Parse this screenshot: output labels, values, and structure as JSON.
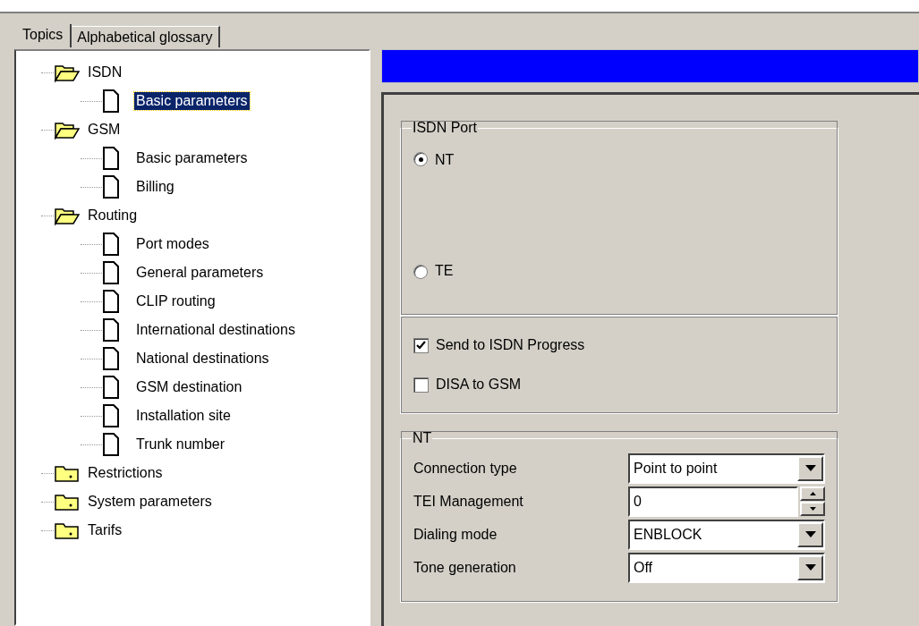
{
  "tabs": [
    {
      "label": "Topics",
      "selected": true
    },
    {
      "label": "Alphabetical glossary",
      "selected": false
    }
  ],
  "tree": [
    {
      "label": "ISDN",
      "expanded": true,
      "selected": false,
      "children": [
        {
          "label": "Basic parameters",
          "selected": true
        }
      ]
    },
    {
      "label": "GSM",
      "expanded": true,
      "selected": false,
      "children": [
        {
          "label": "Basic parameters",
          "selected": false
        },
        {
          "label": "Billing",
          "selected": false
        }
      ]
    },
    {
      "label": "Routing",
      "expanded": true,
      "selected": false,
      "children": [
        {
          "label": "Port modes",
          "selected": false
        },
        {
          "label": "General parameters",
          "selected": false
        },
        {
          "label": "CLIP routing",
          "selected": false
        },
        {
          "label": "International destinations",
          "selected": false
        },
        {
          "label": "National destinations",
          "selected": false
        },
        {
          "label": "GSM destination",
          "selected": false
        },
        {
          "label": "Installation site",
          "selected": false
        },
        {
          "label": "Trunk number",
          "selected": false
        }
      ]
    },
    {
      "label": "Restrictions",
      "expanded": false,
      "selected": false
    },
    {
      "label": "System parameters",
      "expanded": false,
      "selected": false
    },
    {
      "label": "Tarifs",
      "expanded": false,
      "selected": false
    }
  ],
  "isdn_port": {
    "title": "ISDN Port",
    "options": [
      {
        "label": "NT",
        "selected": true
      },
      {
        "label": "TE",
        "selected": false
      }
    ]
  },
  "checkboxes": [
    {
      "label": "Send to ISDN Progress",
      "checked": true
    },
    {
      "label": "DISA to GSM",
      "checked": false
    }
  ],
  "nt": {
    "title": "NT",
    "fields": [
      {
        "kind": "dropdown",
        "label": "Connection type",
        "value": "Point to point"
      },
      {
        "kind": "spinner",
        "label": "TEI Management",
        "value": "0"
      },
      {
        "kind": "dropdown",
        "label": "Dialing mode",
        "value": "ENBLOCK"
      },
      {
        "kind": "dropdown",
        "label": "Tone generation",
        "value": "Off"
      }
    ]
  }
}
